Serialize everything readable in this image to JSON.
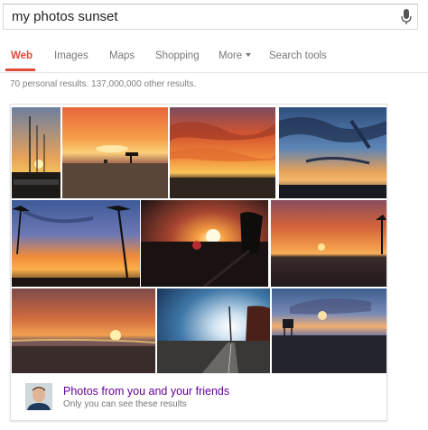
{
  "search": {
    "query": "my photos sunset"
  },
  "tabs": [
    {
      "label": "Web",
      "active": true
    },
    {
      "label": "Images"
    },
    {
      "label": "Maps"
    },
    {
      "label": "Shopping"
    },
    {
      "label": "More"
    },
    {
      "label": "Search tools"
    }
  ],
  "stats": "70 personal results. 137,000,000 other results.",
  "photos_from_friends": {
    "title": "Photos from you and your friends",
    "subtitle": "Only you can see these results"
  },
  "colors": {
    "accent": "#dd4b39",
    "link": "#660099",
    "muted": "#777777"
  }
}
